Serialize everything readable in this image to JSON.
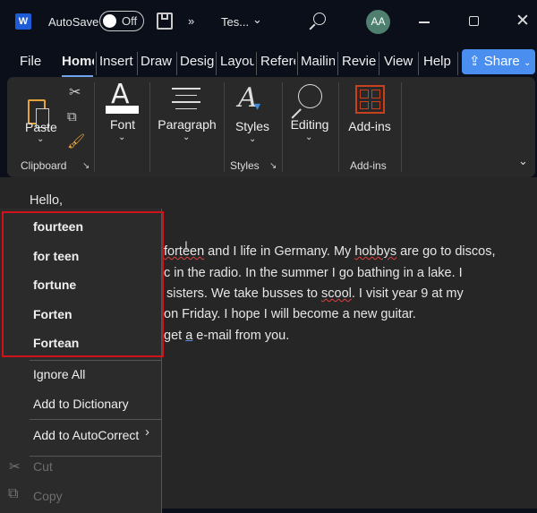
{
  "titlebar": {
    "autosave_label": "AutoSave",
    "toggle_state": "Off",
    "more": "»",
    "doc_title": "Tes...",
    "avatar": "AA"
  },
  "tabs": [
    "File",
    "Home",
    "Insert",
    "Draw",
    "Design",
    "Layout",
    "References",
    "Mailings",
    "Review",
    "View",
    "Help"
  ],
  "share_label": "Share",
  "ribbon": {
    "paste": "Paste",
    "font": "Font",
    "paragraph": "Paragraph",
    "styles": "Styles",
    "editing": "Editing",
    "addins": "Add-ins",
    "groups": {
      "clipboard": "Clipboard",
      "styles": "Styles",
      "addins": "Add-ins"
    }
  },
  "document": {
    "greeting": "Hello,",
    "lines": [
      {
        "pre": "",
        "err": "forteen",
        "post": " and I life in Germany. My ",
        "err2": "hobbys",
        "post2": " are go to discos,"
      },
      {
        "text": "c in the radio. In the summer I go bathing in a lake. I"
      },
      {
        "pre": "sisters. We take busses to ",
        "err": "scool",
        "post": ". I visit year 9 at my"
      },
      {
        "text": "on Friday. I hope I will become a new guitar."
      },
      {
        "pre": "get ",
        "err": "a",
        "post": " e-mail from you."
      }
    ]
  },
  "context_menu": {
    "suggestions": [
      "fourteen",
      "for teen",
      "fortune",
      "Forten",
      "Fortean"
    ],
    "ignore_all": "Ignore All",
    "add_dictionary": "Add to Dictionary",
    "add_autocorrect": "Add to AutoCorrect",
    "cut": "Cut",
    "copy": "Copy"
  },
  "colors": {
    "accent": "#4a8ef0",
    "highlight_box": "#d0131b",
    "addins_icon": "#c8401c"
  }
}
